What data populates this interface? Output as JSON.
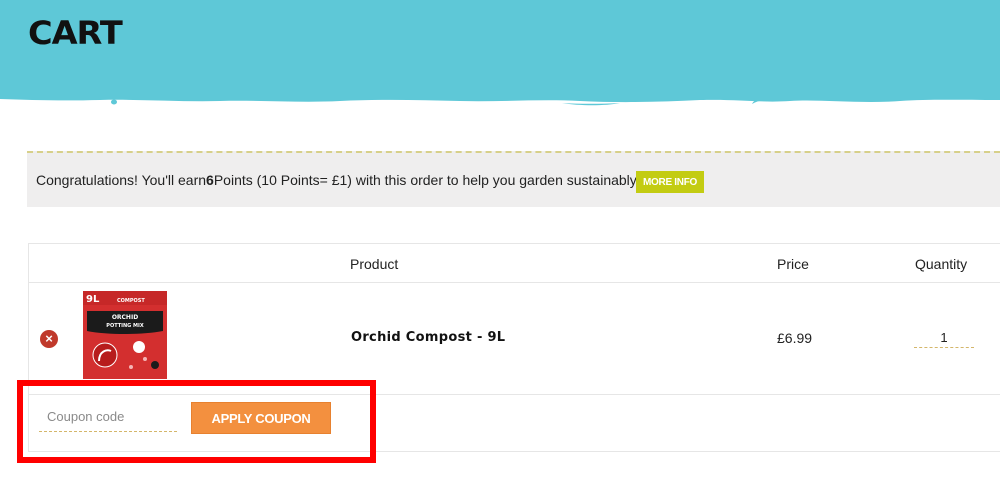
{
  "header": {
    "title": "CART",
    "banner_color": "#5ec8d7"
  },
  "points_notice": {
    "text_before": "Congratulations! You'll earn",
    "points_value": "6",
    "text_after": "Points (10 Points= £1) with this order to help you garden sustainably.",
    "more_info_label": "MORE INFO",
    "accent_color": "#c3cc12"
  },
  "cart_table": {
    "columns": {
      "product": "Product",
      "price": "Price",
      "quantity": "Quantity"
    },
    "items": [
      {
        "name": "Orchid Compost - 9L",
        "price": "£6.99",
        "quantity": "1",
        "remove_icon": "close-circle-icon",
        "thumbnail": {
          "size_label": "9L",
          "brand": "COMPOST",
          "line1": "ORCHID",
          "line2": "POTTING MIX"
        }
      }
    ]
  },
  "coupon": {
    "placeholder": "Coupon code",
    "value": "",
    "apply_label": "APPLY COUPON",
    "button_color": "#f3903f"
  },
  "highlight": {
    "color": "#ff0000"
  }
}
